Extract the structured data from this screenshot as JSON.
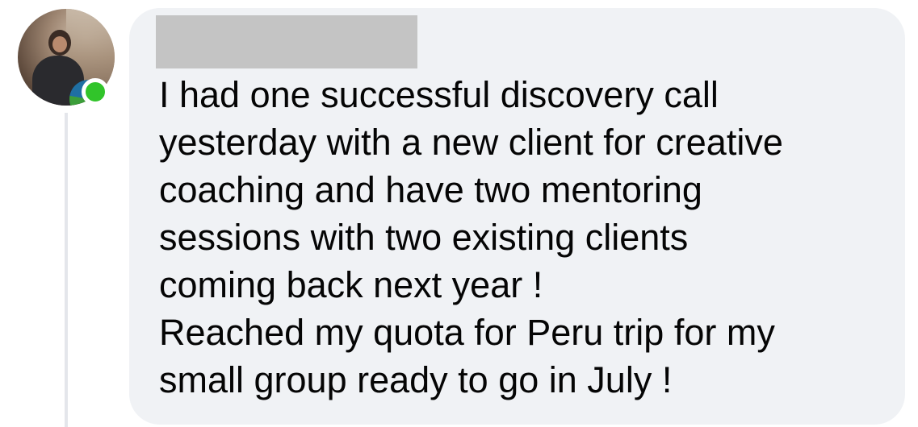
{
  "comment": {
    "author_name": "",
    "lines": [
      "I had one successful discovery call",
      "yesterday with a new client for creative",
      "coaching and have two mentoring",
      "sessions with two existing clients",
      "coming back next year !",
      "Reached my quota for Peru trip for my",
      "small group ready to go in July !"
    ]
  },
  "avatar": {
    "icon": "user-avatar",
    "badge_icon": "community-logo-icon",
    "status": "online",
    "status_color": "#31c42a"
  },
  "colors": {
    "bubble": "#f0f2f5",
    "text": "#050505",
    "redaction": "#c4c4c4",
    "thread_line": "#e4e6eb"
  }
}
